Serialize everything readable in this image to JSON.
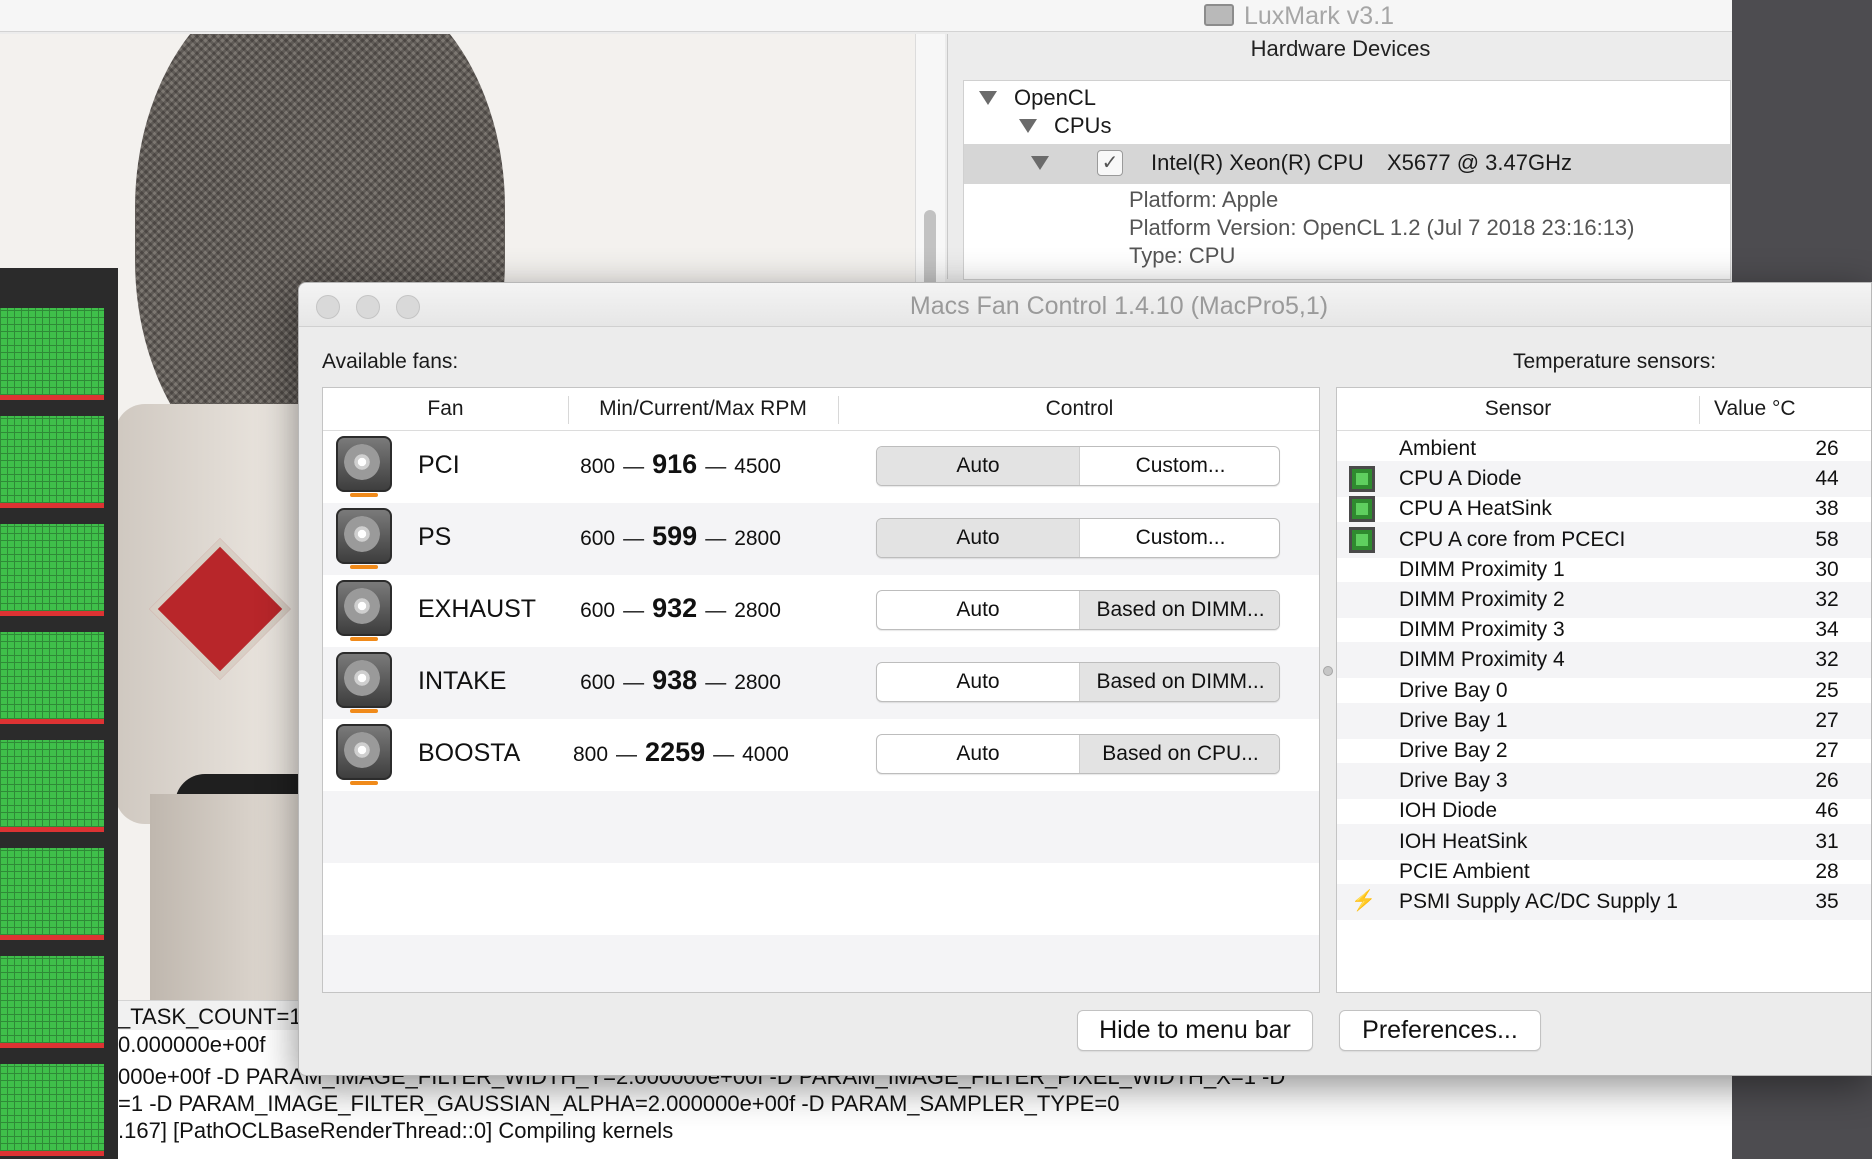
{
  "luxmark": {
    "title": "LuxMark v3.1",
    "hardware_heading": "Hardware Devices",
    "tree": {
      "opencl": "OpenCL",
      "cpus": "CPUs",
      "cpu_name": "Intel(R) Xeon(R) CPU",
      "cpu_model": "X5677  @ 3.47GHz",
      "platform": "Platform: Apple",
      "platform_version": "Platform Version: OpenCL 1.2 (Jul  7 2018 23:16:13)",
      "type": "Type: CPU"
    },
    "console_lines": [
      "_TASK_COUNT=1",
      "0.000000e+00f",
      "000e+00f -D PARAM_IMAGE_FILTER_WIDTH_Y=2.000000e+00f -D PARAM_IMAGE_FILTER_PIXEL_WIDTH_X=1 -D",
      "=1 -D PARAM_IMAGE_FILTER_GAUSSIAN_ALPHA=2.000000e+00f -D PARAM_SAMPLER_TYPE=0",
      ".167] [PathOCLBaseRenderThread::0] Compiling kernels"
    ]
  },
  "mfc": {
    "title": "Macs Fan Control 1.4.10 (MacPro5,1)",
    "available_fans_label": "Available fans:",
    "temperature_sensors_label": "Temperature sensors:",
    "fan_columns": {
      "fan": "Fan",
      "rpm": "Min/Current/Max RPM",
      "control": "Control"
    },
    "sensor_columns": {
      "sensor": "Sensor",
      "value": "Value °C"
    },
    "dash": "—",
    "fans": [
      {
        "name": "PCI",
        "min": "800",
        "current": "916",
        "max": "4500",
        "auto": "Auto",
        "custom": "Custom...",
        "mode": "auto"
      },
      {
        "name": "PS",
        "min": "600",
        "current": "599",
        "max": "2800",
        "auto": "Auto",
        "custom": "Custom...",
        "mode": "auto"
      },
      {
        "name": "EXHAUST",
        "min": "600",
        "current": "932",
        "max": "2800",
        "auto": "Auto",
        "custom": "Based on DIMM...",
        "mode": "custom"
      },
      {
        "name": "INTAKE",
        "min": "600",
        "current": "938",
        "max": "2800",
        "auto": "Auto",
        "custom": "Based on DIMM...",
        "mode": "custom"
      },
      {
        "name": "BOOSTA",
        "min": "800",
        "current": "2259",
        "max": "4000",
        "auto": "Auto",
        "custom": "Based on CPU...",
        "mode": "custom"
      }
    ],
    "sensors": [
      {
        "name": "Ambient",
        "value": "26",
        "icon": ""
      },
      {
        "name": "CPU A Diode",
        "value": "44",
        "icon": "chip-icon"
      },
      {
        "name": "CPU A HeatSink",
        "value": "38",
        "icon": "chip-icon"
      },
      {
        "name": "CPU A core from PCECI",
        "value": "58",
        "icon": "chip-icon"
      },
      {
        "name": "DIMM Proximity 1",
        "value": "30",
        "icon": ""
      },
      {
        "name": "DIMM Proximity 2",
        "value": "32",
        "icon": ""
      },
      {
        "name": "DIMM Proximity 3",
        "value": "34",
        "icon": ""
      },
      {
        "name": "DIMM Proximity 4",
        "value": "32",
        "icon": ""
      },
      {
        "name": "Drive Bay 0",
        "value": "25",
        "icon": ""
      },
      {
        "name": "Drive Bay 1",
        "value": "27",
        "icon": ""
      },
      {
        "name": "Drive Bay 2",
        "value": "27",
        "icon": ""
      },
      {
        "name": "Drive Bay 3",
        "value": "26",
        "icon": ""
      },
      {
        "name": "IOH Diode",
        "value": "46",
        "icon": ""
      },
      {
        "name": "IOH HeatSink",
        "value": "31",
        "icon": ""
      },
      {
        "name": "PCIE Ambient",
        "value": "28",
        "icon": ""
      },
      {
        "name": "PSMI Supply AC/DC Supply 1",
        "value": "35",
        "icon": "bolt-icon"
      }
    ],
    "hide_button": "Hide to menu bar",
    "preferences_button": "Preferences..."
  }
}
